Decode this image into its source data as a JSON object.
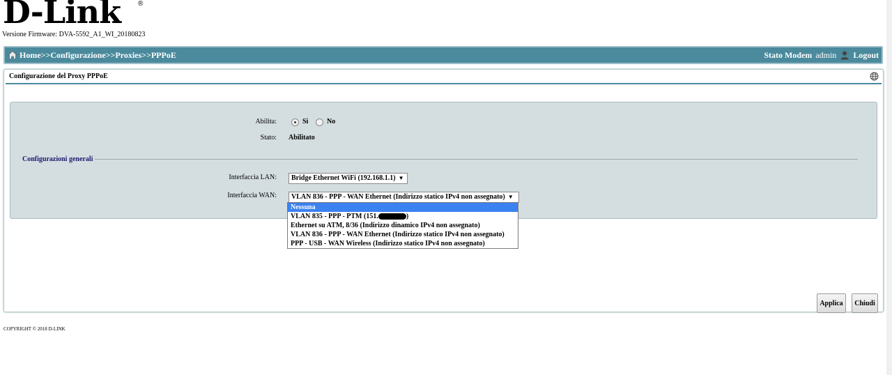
{
  "brand": {
    "logo": "D-Link",
    "reg": "®"
  },
  "firmware": "Versione Firmware: DVA-5592_A1_WI_20180823",
  "navbar": {
    "breadcrumb": [
      "Home",
      "Configurazione",
      "Proxies",
      "PPPoE"
    ],
    "separator": ">>",
    "status_link": "Stato Modem",
    "user": "admin",
    "logout": "Logout",
    "color": "#4a8a9c"
  },
  "panel": {
    "title": "Configurazione del Proxy PPPoE"
  },
  "form": {
    "enable_label": "Abilita:",
    "enable_yes": "Si",
    "enable_no": "No",
    "enable_value": "Si",
    "status_label": "Stato:",
    "status_value": "Abilitato",
    "section_title": "Configurazioni generali",
    "lan_label": "Interfaccia LAN:",
    "lan_value": "Bridge Ethernet WiFi (192.168.1.1)",
    "wan_label": "Interfaccia WAN:",
    "wan_value": "VLAN 836 - PPP - WAN Ethernet (Indirizzo statico IPv4 non assegnato)",
    "wan_options": [
      "Nessuna",
      "VLAN 835 - PPP - PTM (151.",
      "Ethernet su ATM, 8/36 (Indirizzo dinamico IPv4 non assegnato)",
      "VLAN 836 - PPP - WAN Ethernet (Indirizzo statico IPv4 non assegnato)",
      "PPP - USB - WAN Wireless (Indirizzo statico IPv4 non assegnato)"
    ],
    "wan_option_1_suffix": ")",
    "highlighted_option": "Nessuna"
  },
  "buttons": {
    "apply": "Applica",
    "close": "Chiudi"
  },
  "footer": {
    "copyright": "COPYRIGHT © 2018 D-LINK"
  }
}
